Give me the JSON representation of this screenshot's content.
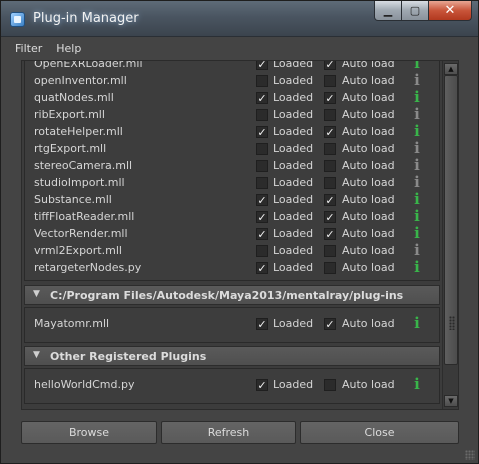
{
  "window": {
    "title": "Plug-in Manager",
    "minimize_glyph": "▁",
    "maximize_glyph": "▢",
    "close_glyph": "✕"
  },
  "menu": [
    "Filter",
    "Help"
  ],
  "labels": {
    "loaded": "Loaded",
    "auto_load": "Auto load",
    "info_glyph": "i"
  },
  "plugin_rows": [
    {
      "name": "OpenEXRLoader.mll",
      "loaded": true,
      "auto_load": true,
      "info": "green"
    },
    {
      "name": "openInventor.mll",
      "loaded": false,
      "auto_load": false,
      "info": "gray"
    },
    {
      "name": "quatNodes.mll",
      "loaded": true,
      "auto_load": true,
      "info": "green"
    },
    {
      "name": "ribExport.mll",
      "loaded": false,
      "auto_load": false,
      "info": "gray"
    },
    {
      "name": "rotateHelper.mll",
      "loaded": true,
      "auto_load": true,
      "info": "green"
    },
    {
      "name": "rtgExport.mll",
      "loaded": false,
      "auto_load": false,
      "info": "gray"
    },
    {
      "name": "stereoCamera.mll",
      "loaded": false,
      "auto_load": false,
      "info": "gray"
    },
    {
      "name": "studioImport.mll",
      "loaded": false,
      "auto_load": false,
      "info": "gray"
    },
    {
      "name": "Substance.mll",
      "loaded": true,
      "auto_load": true,
      "info": "green"
    },
    {
      "name": "tiffFloatReader.mll",
      "loaded": true,
      "auto_load": true,
      "info": "green"
    },
    {
      "name": "VectorRender.mll",
      "loaded": true,
      "auto_load": true,
      "info": "green"
    },
    {
      "name": "vrml2Export.mll",
      "loaded": false,
      "auto_load": false,
      "info": "gray"
    },
    {
      "name": "retargeterNodes.py",
      "loaded": true,
      "auto_load": false,
      "info": "green"
    }
  ],
  "sections": [
    {
      "title": "C:/Program Files/Autodesk/Maya2013/mentalray/plug-ins",
      "rows": [
        {
          "name": "Mayatomr.mll",
          "loaded": true,
          "auto_load": true,
          "info": "green"
        }
      ]
    },
    {
      "title": "Other Registered Plugins",
      "rows": [
        {
          "name": "helloWorldCmd.py",
          "loaded": true,
          "auto_load": false,
          "info": "green"
        }
      ]
    }
  ],
  "buttons": {
    "browse": "Browse",
    "refresh": "Refresh",
    "close": "Close"
  },
  "colors": {
    "info_green": "#39b54a",
    "info_gray": "#8a8a8a",
    "window_bg": "#444444"
  }
}
